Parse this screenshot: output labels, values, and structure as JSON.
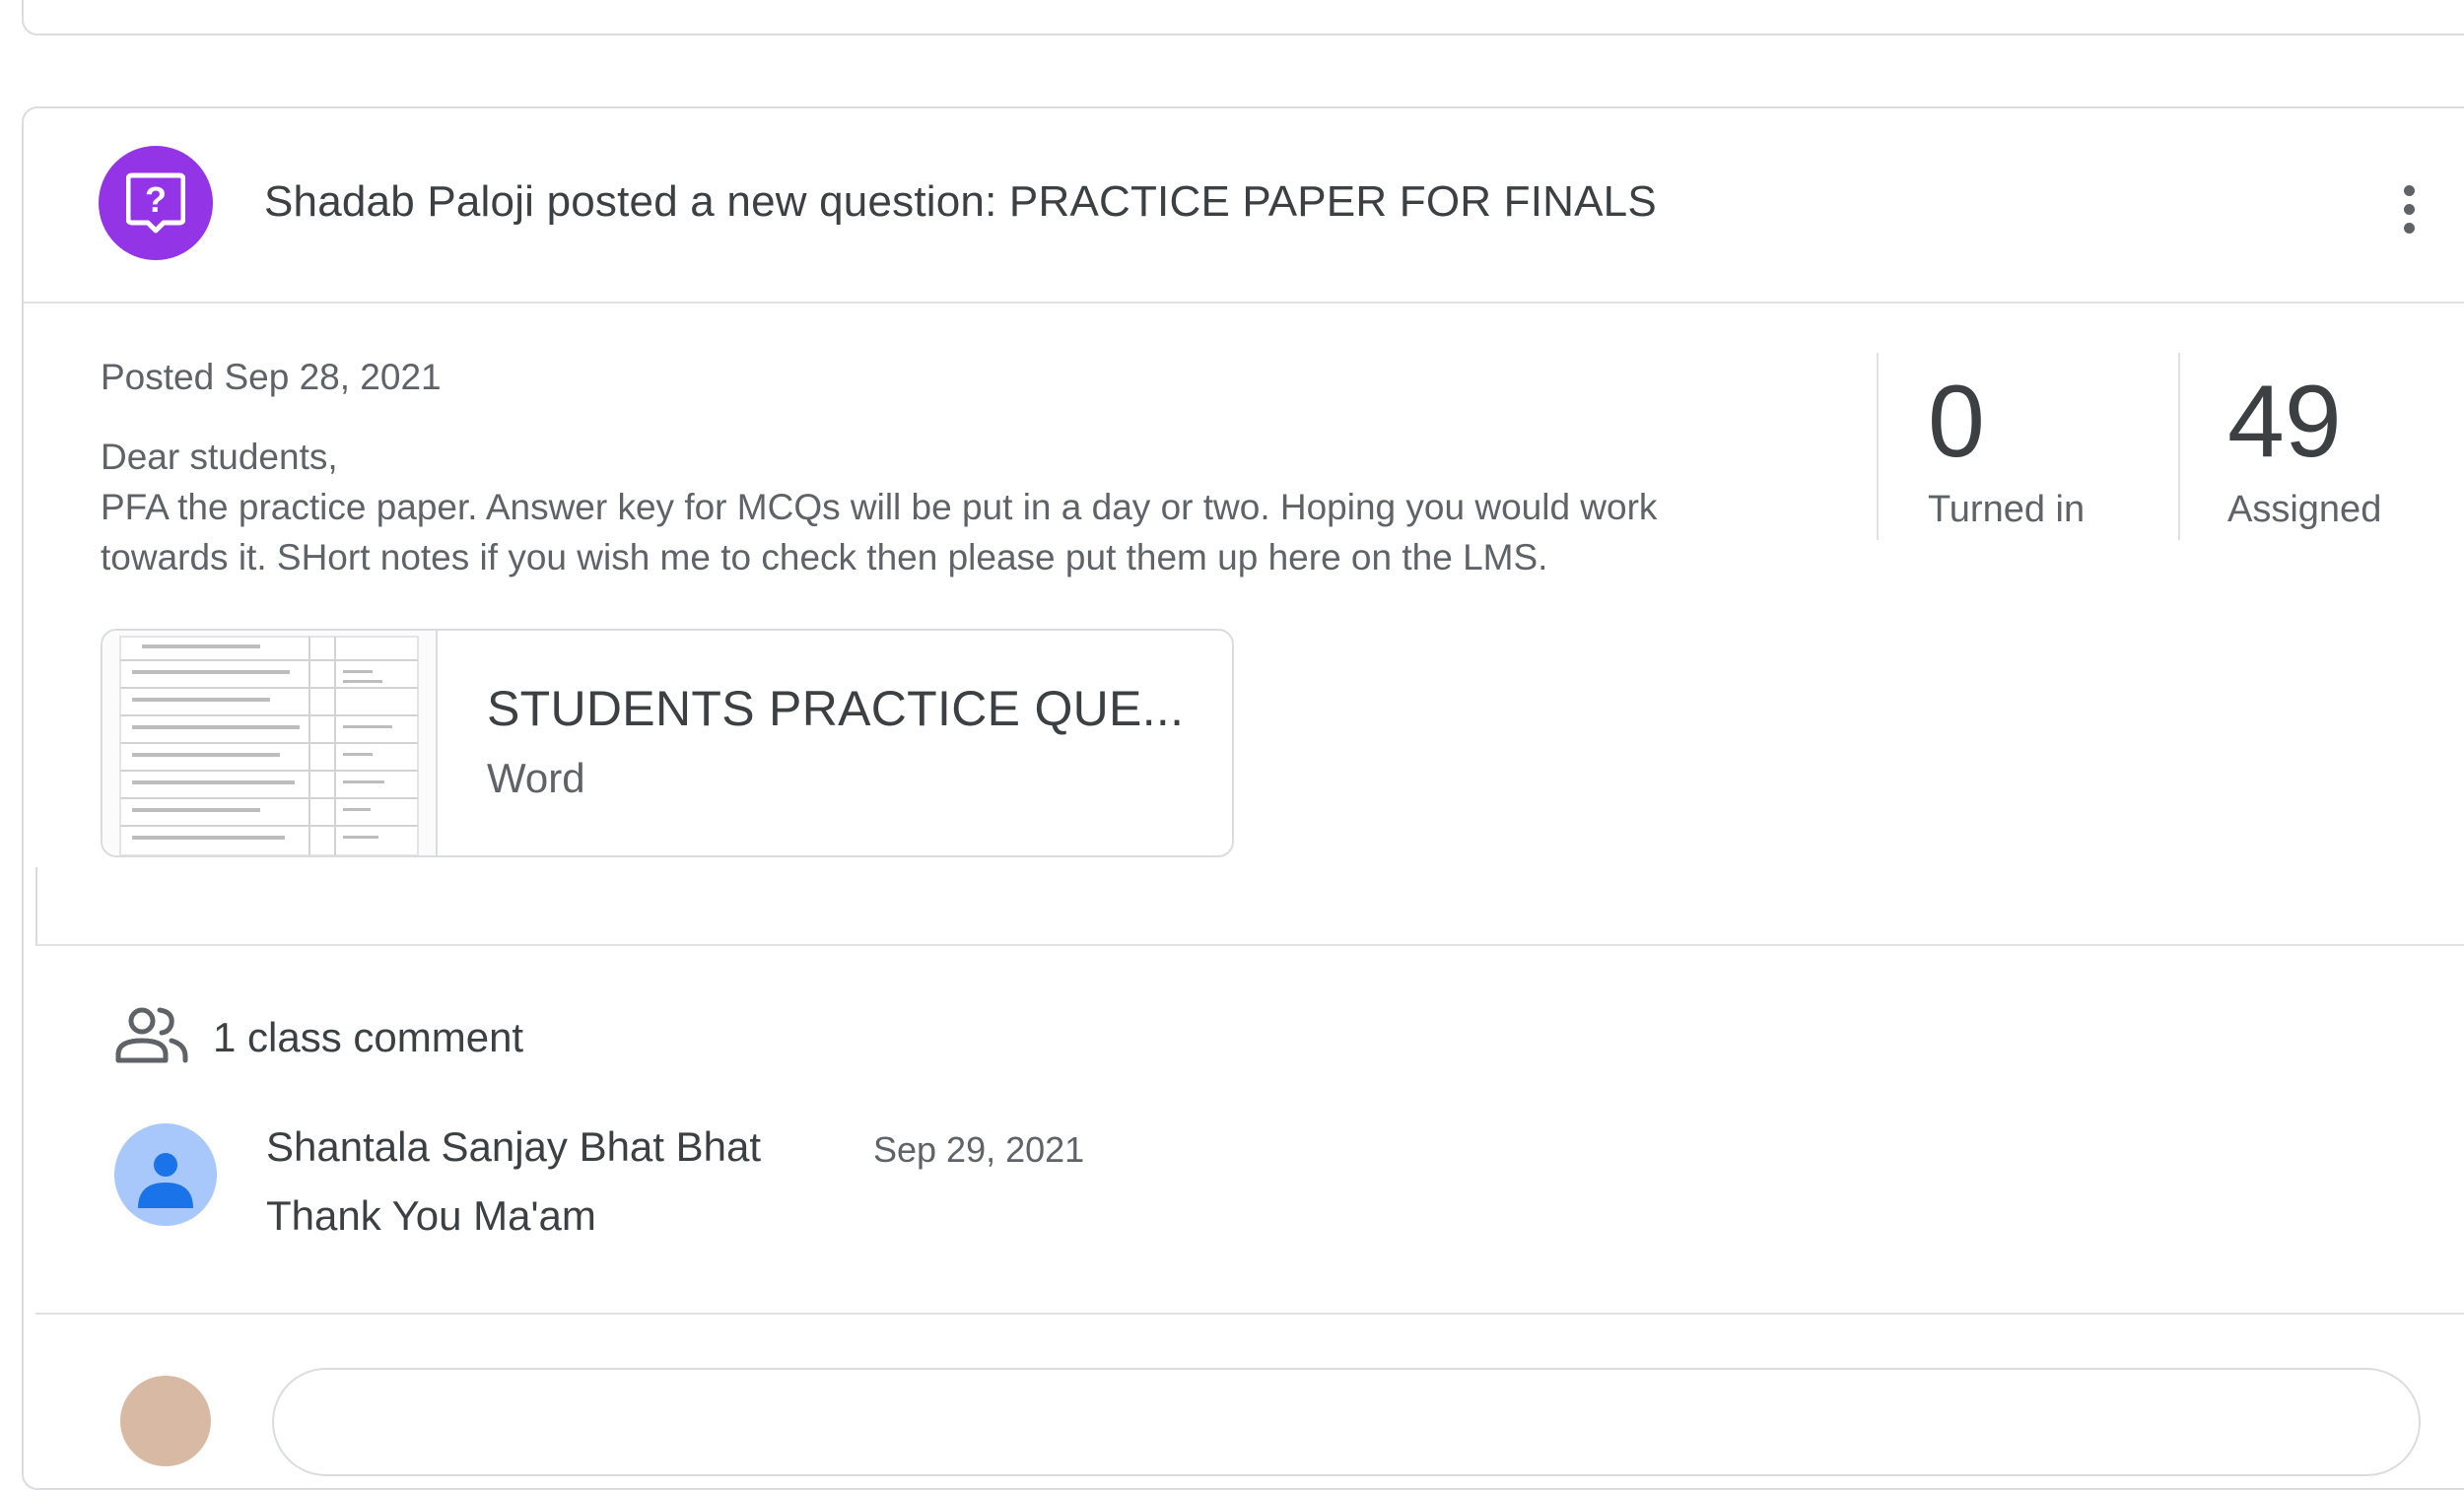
{
  "post": {
    "title": "Shadab Paloji posted a new question: PRACTICE PAPER FOR FINALS",
    "posted_date": "Posted Sep 28, 2021",
    "body_lines": [
      "Dear students,",
      "PFA the practice paper. Answer key for MCQs will be put in a day or two. Hoping you would work",
      "towards it. SHort notes if you wish me to check then please put them up here on the LMS."
    ],
    "stats": {
      "turned_in_count": "0",
      "turned_in_label": "Turned in",
      "assigned_count": "49",
      "assigned_label": "Assigned"
    },
    "attachment": {
      "title": "STUDENTS PRACTICE QUE...",
      "type": "Word"
    }
  },
  "comments": {
    "header_label": "1 class comment",
    "items": [
      {
        "author": "Shantala Sanjay Bhat Bhat",
        "date": "Sep 29, 2021",
        "text": "Thank You Ma'am"
      }
    ]
  },
  "colors": {
    "question_accent": "#9334e6",
    "text_primary": "#3c4043",
    "text_secondary": "#5f6368",
    "border": "#dadce0"
  },
  "icons": {
    "post_type": "question-icon",
    "menu": "more-vert-icon",
    "comments": "people-icon",
    "comment_avatar": "person-avatar-icon"
  }
}
